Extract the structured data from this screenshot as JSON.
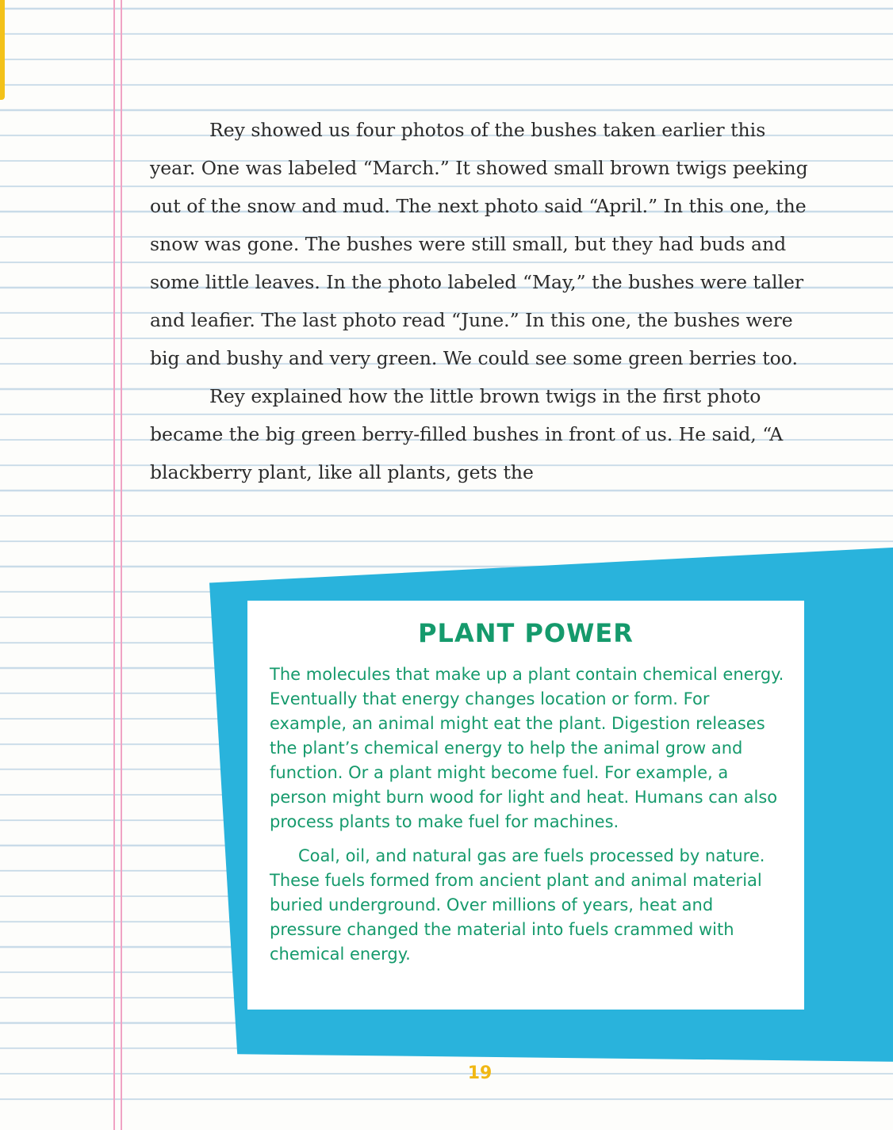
{
  "main": {
    "paragraphs": [
      "Rey showed us four photos of the bushes taken earlier this year. One was labeled “March.” It showed small brown twigs peeking out of the snow and mud. The next photo said “April.” In this one, the snow was gone. The bushes were still small, but they had buds and some little leaves. In the photo labeled “May,” the bushes were taller and leafier. The last photo read “June.” In this one, the bushes were big and bushy and very green. We could see some green berries too.",
      "Rey explained how the little brown twigs in the first photo became the big green berry-filled bushes in front of us. He said, “A blackberry plant, like all plants, gets the"
    ]
  },
  "sidebar_box": {
    "title": "PLANT POWER",
    "paragraphs": [
      "The molecules that make up a plant contain chemical energy. Eventually that energy changes location or form. For example, an animal might eat the plant. Digestion releases the plant’s chemical energy to help the animal grow and function. Or a plant might become fuel. For example, a person might burn wood for light and heat. Humans can also process plants to make fuel for machines.",
      "Coal, oil, and natural gas are fuels processed by nature. These fuels formed from ancient plant and animal material buried underground. Over millions of years, heat and pressure changed the material into fuels crammed with chemical energy."
    ]
  },
  "footer": {
    "page_number": "19"
  },
  "colors": {
    "paper": "#fdfdfb",
    "ruled_line": "#c9dbe8",
    "margin_line": "#f0a3c4",
    "panel_blue": "#29b3dc",
    "note_green": "#159a6c",
    "page_number_yellow": "#f1b814"
  }
}
